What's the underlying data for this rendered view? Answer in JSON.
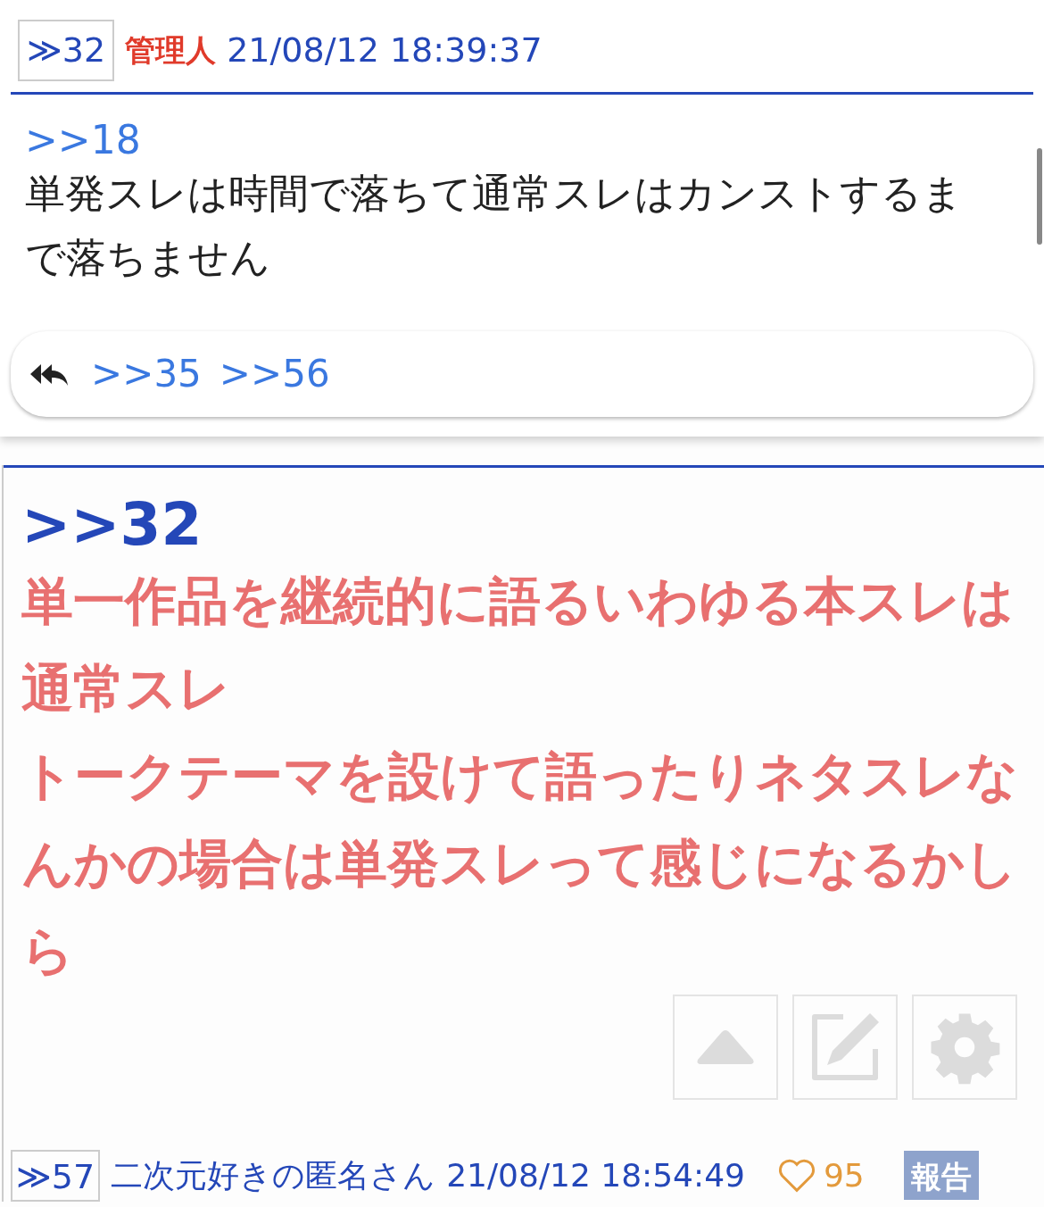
{
  "popup": {
    "post_number": "≫32",
    "author": "管理人",
    "timestamp": "21/08/12 18:39:37",
    "anchor": ">>18",
    "body": "単発スレは時間で落ちて通常スレはカンストするまで落ちません",
    "replies": [
      ">>35",
      ">>56"
    ]
  },
  "post": {
    "anchor": ">>32",
    "lines": [
      "単一作品を継続的に語るいわゆる本スレは通常スレ",
      "トークテーマを設けて語ったりネタスレなんかの場合は単発スレって感じになるかしら"
    ]
  },
  "next_post": {
    "post_number": "≫57",
    "author": "二次元好きの匿名さん",
    "timestamp": "21/08/12 18:54:49",
    "likes": "95",
    "report": "報告"
  }
}
